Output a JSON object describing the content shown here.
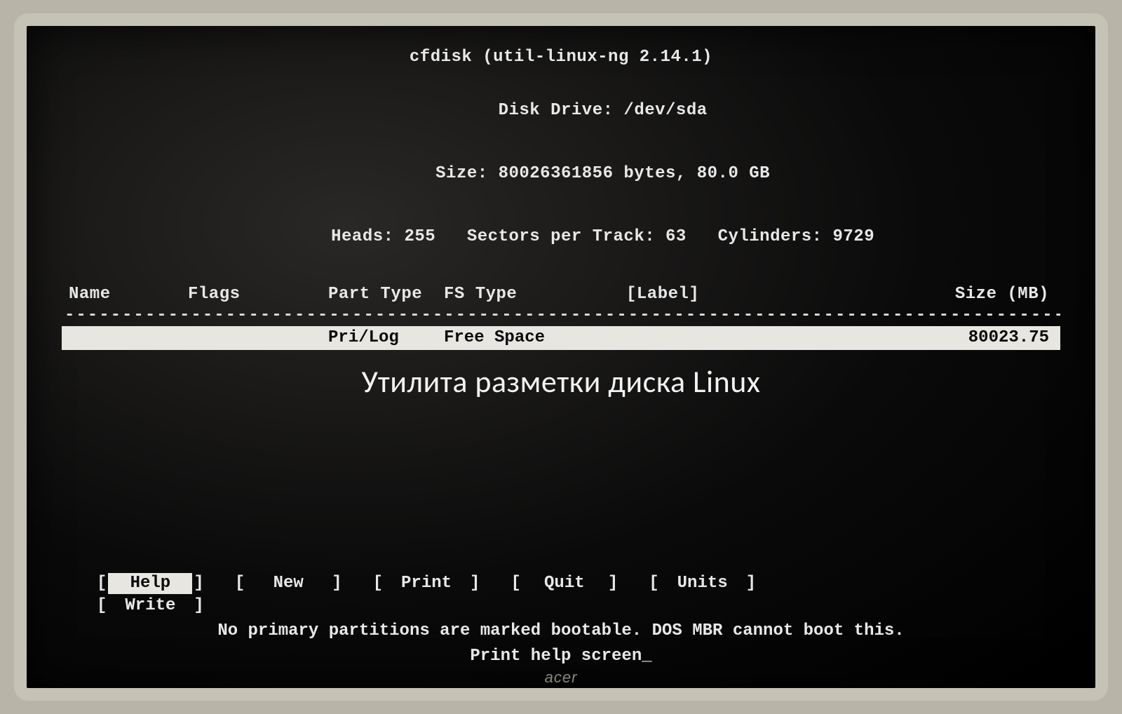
{
  "header": {
    "title": "cfdisk (util-linux-ng 2.14.1)",
    "disk_drive_label": "Disk Drive:",
    "disk_drive_value": "/dev/sda",
    "size_label": "Size:",
    "size_bytes": "80026361856",
    "size_bytes_unit": "bytes,",
    "size_gb": "80.0 GB",
    "heads_label": "Heads:",
    "heads_value": "255",
    "sectors_label": "Sectors per Track:",
    "sectors_value": "63",
    "cylinders_label": "Cylinders:",
    "cylinders_value": "9729"
  },
  "columns": {
    "name": "Name",
    "flags": "Flags",
    "part_type": "Part Type",
    "fs_type": "FS Type",
    "label": "[Label]",
    "size": "Size (MB)"
  },
  "rows": [
    {
      "name": "",
      "flags": "",
      "part_type": "Pri/Log",
      "fs_type": "Free Space",
      "label": "",
      "size": "80023.75",
      "selected": true
    }
  ],
  "menu": {
    "row1": [
      {
        "label": "Help",
        "selected": true
      },
      {
        "label": "New",
        "selected": false
      },
      {
        "label": "Print",
        "selected": false
      },
      {
        "label": "Quit",
        "selected": false
      },
      {
        "label": "Units",
        "selected": false
      }
    ],
    "row2": [
      {
        "label": "Write",
        "selected": false
      }
    ]
  },
  "status": {
    "warning": "No primary partitions are marked bootable. DOS MBR cannot boot this.",
    "hint": "Print help screen"
  },
  "overlay_caption": "Утилита разметки диска Linux",
  "dash_row": "------------------------------------------------------------------------------------------------",
  "brand": "acer",
  "brackets": {
    "open": "[",
    "close": "]"
  }
}
